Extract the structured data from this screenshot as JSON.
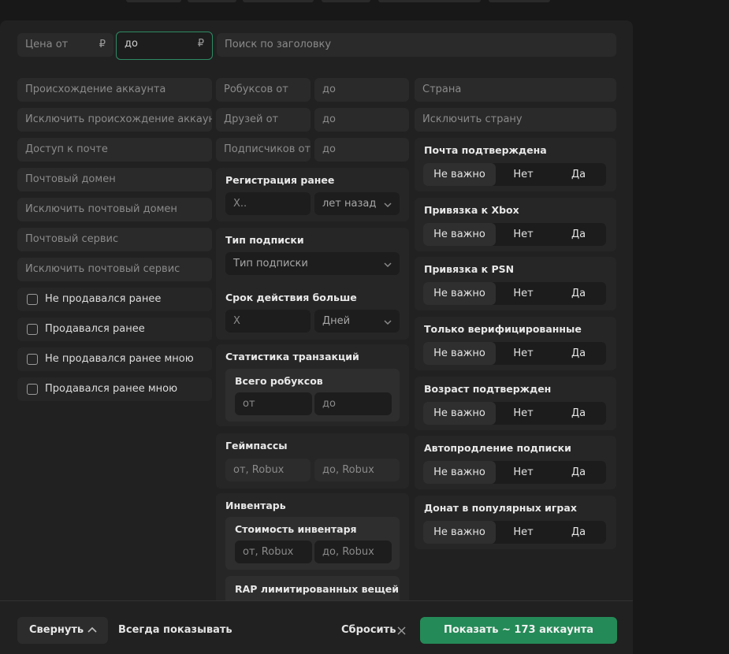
{
  "price": {
    "from_placeholder": "Цена от",
    "to_value": "до",
    "currency": "₽",
    "title_search_placeholder": "Поиск по заголовку"
  },
  "left": {
    "origin": "Происхождение аккаунта",
    "exclude_origin": "Исключить происхождение аккаунт",
    "mail_access": "Доступ к почте",
    "mail_domain": "Почтовый домен",
    "exclude_mail_domain": "Исключить почтовый домен",
    "mail_service": "Почтовый сервис",
    "exclude_mail_service": "Исключить почтовый сервис",
    "checkboxes": [
      "Не продавался ранее",
      "Продавался ранее",
      "Не продавался ранее мною",
      "Продавался ранее мною"
    ]
  },
  "middle": {
    "robux_from": "Робуксов от",
    "friends_from": "Друзей от",
    "subs_from": "Подписчиков от",
    "to": "до",
    "reg": {
      "title": "Регистрация ранее",
      "x_placeholder": "X..",
      "unit": "лет назад"
    },
    "sub": {
      "title": "Тип подписки",
      "type_placeholder": "Тип подписки",
      "duration_title": "Срок действия больше",
      "x_placeholder": "X",
      "unit": "Дней"
    },
    "stats": {
      "title": "Статистика транзакций",
      "total_title": "Всего робуксов",
      "from": "от",
      "to": "до"
    },
    "gamepasses": {
      "title": "Геймпассы",
      "from": "от, Robux",
      "to": "до, Robux"
    },
    "inventory": {
      "title": "Инвентарь",
      "cost_title": "Стоимость инвентаря",
      "from": "от, Robux",
      "to": "до, Robux",
      "rap_title": "RAP лимитированных вещей"
    }
  },
  "right": {
    "country": "Страна",
    "exclude_country": "Исключить страну",
    "options": [
      "Не важно",
      "Нет",
      "Да"
    ],
    "toggles": [
      "Почта подтверждена",
      "Привязка к Xbox",
      "Привязка к PSN",
      "Только верифицированные",
      "Возраст подтвержден",
      "Автопродление подписки",
      "Донат в популярных играх"
    ]
  },
  "footer": {
    "collapse": "Свернуть",
    "always_show": "Всегда показывать",
    "reset": "Сбросить",
    "show": "Показать ~ 173 аккаунта"
  },
  "colors": {
    "accent": "#248a57",
    "focus_border": "#2e8a64"
  }
}
